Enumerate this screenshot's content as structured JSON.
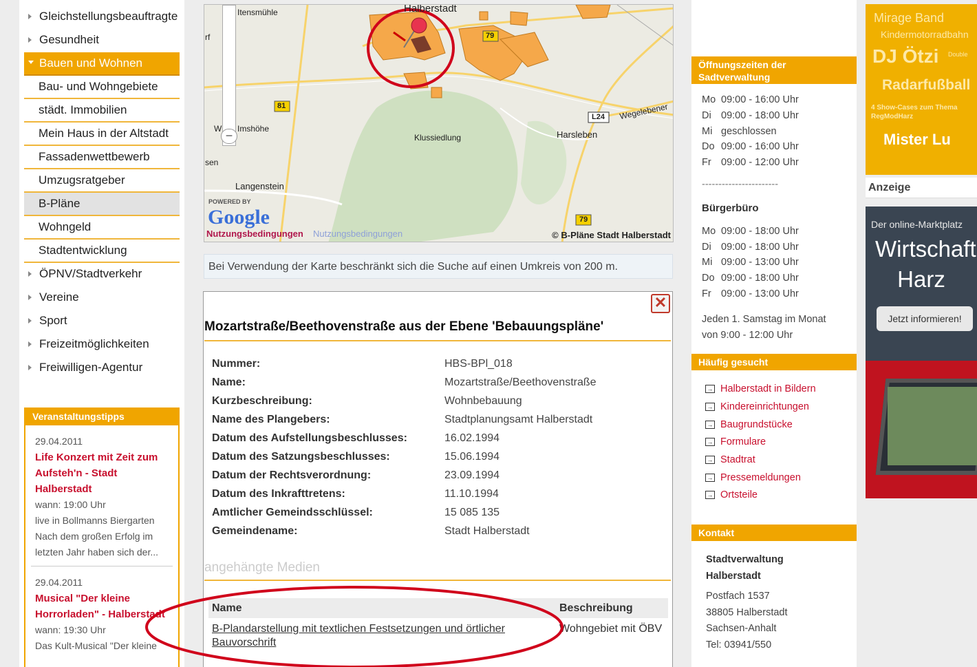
{
  "nav": {
    "items": [
      {
        "label": "Gleichstellungsbeauftragte",
        "type": "top"
      },
      {
        "label": "Gesundheit",
        "type": "top"
      },
      {
        "label": "Bauen und Wohnen",
        "type": "active"
      },
      {
        "label": "Bau- und Wohngebiete",
        "type": "sub"
      },
      {
        "label": "städt. Immobilien",
        "type": "sub"
      },
      {
        "label": "Mein Haus in der Altstadt",
        "type": "sub"
      },
      {
        "label": "Fassadenwettbewerb",
        "type": "sub"
      },
      {
        "label": "Umzugsratgeber",
        "type": "sub"
      },
      {
        "label": "B-Pläne",
        "type": "current"
      },
      {
        "label": "Wohngeld",
        "type": "sub"
      },
      {
        "label": "Stadtentwicklung",
        "type": "sub"
      },
      {
        "label": "ÖPNV/Stadtverkehr",
        "type": "top"
      },
      {
        "label": "Vereine",
        "type": "top"
      },
      {
        "label": "Sport",
        "type": "top"
      },
      {
        "label": "Freizeitmöglichkeiten",
        "type": "top"
      },
      {
        "label": "Freiwilligen-Agentur",
        "type": "top"
      }
    ]
  },
  "events": {
    "heading": "Veranstaltungstipps",
    "items": [
      {
        "date": "29.04.2011",
        "title": "Life Konzert mit Zeit zum Aufsteh'n - Stadt Halberstadt",
        "when": "wann: 19:00   Uhr",
        "desc": "live in Bollmanns Biergarten Nach dem großen Erfolg im letzten Jahr haben sich der..."
      },
      {
        "date": "29.04.2011",
        "title": "Musical \"Der kleine Horrorladen\" - Halberstadt",
        "when": "wann: 19:30   Uhr",
        "desc": "Das Kult-Musical \"Der kleine"
      }
    ]
  },
  "map": {
    "labels": {
      "halberstadt": "Halberstadt",
      "spiegelsberge": "Itensmühle",
      "imshoehe": "Imshöhe",
      "klussiedlung": "Klussiedlung",
      "harsleben": "Harsleben",
      "langenstein": "Langenstein",
      "wegeleben": "Wegelebener",
      "road81": "81",
      "road79a": "79",
      "road79b": "79",
      "l24": "L24",
      "rf": "rf",
      "sen": "sen",
      "w": "W"
    },
    "powered": "POWERED BY",
    "google": "Google",
    "terms": "Nutzungsbedingungen",
    "terms_ghost": "Nutzungsbedingungen",
    "copyright": "© B-Pläne Stadt Halberstadt",
    "zoom_minus": "−"
  },
  "hint": "Bei Verwendung der Karte beschränkt sich die Suche auf einen Umkreis von 200 m.",
  "popup": {
    "close": "✕",
    "title": "Mozartstraße/Beethovenstraße aus der Ebene 'Bebauungspläne'",
    "details": [
      {
        "k": "Nummer:",
        "v": "HBS-BPl_018"
      },
      {
        "k": "Name:",
        "v": "Mozartstraße/Beethovenstraße"
      },
      {
        "k": "Kurzbeschreibung:",
        "v": "Wohnbebauung"
      },
      {
        "k": "Name des Plangebers:",
        "v": "Stadtplanungsamt Halberstadt"
      },
      {
        "k": "Datum des Aufstellungsbeschlusses:",
        "v": "16.02.1994"
      },
      {
        "k": "Datum des Satzungsbeschlusses:",
        "v": "15.06.1994"
      },
      {
        "k": "Datum der Rechtsverordnung:",
        "v": "23.09.1994"
      },
      {
        "k": "Datum des Inkrafttretens:",
        "v": "11.10.1994"
      },
      {
        "k": "Amtlicher Gemeindsschlüssel:",
        "v": "15 085 135"
      },
      {
        "k": "Gemeindename:",
        "v": "Stadt Halberstadt"
      }
    ],
    "media_heading": "angehängte Medien",
    "media_cols": {
      "name": "Name",
      "desc": "Beschreibung"
    },
    "media_row": {
      "name": "B-Plandarstellung mit textlichen Festsetzungen und örtlicher Bauvorschrift",
      "desc": "Wohngebiet mit ÖBV"
    }
  },
  "right": {
    "hours_heading": "Öffnungszeiten der Sadtverwaltung",
    "hours": [
      {
        "d": "Mo",
        "t": "09:00 - 16:00 Uhr"
      },
      {
        "d": "Di",
        "t": "09:00 - 18:00 Uhr"
      },
      {
        "d": "Mi",
        "t": "geschlossen"
      },
      {
        "d": "Do",
        "t": "09:00 - 16:00 Uhr"
      },
      {
        "d": "Fr",
        "t": "09:00 - 12:00 Uhr"
      }
    ],
    "sep": "-----------------------",
    "buero_heading": "Bürgerbüro",
    "buero_hours": [
      {
        "d": "Mo",
        "t": "09:00 - 18:00 Uhr"
      },
      {
        "d": "Di",
        "t": "09:00 - 18:00 Uhr"
      },
      {
        "d": "Mi",
        "t": "09:00 - 13:00 Uhr"
      },
      {
        "d": "Do",
        "t": "09:00 - 18:00 Uhr"
      },
      {
        "d": "Fr",
        "t": "09:00 - 13:00 Uhr"
      }
    ],
    "saturday": "Jeden 1. Samstag im Monat von 9:00 - 12:00 Uhr",
    "frequent_heading": "Häufig gesucht",
    "links": [
      "Halberstadt in Bildern",
      "Kindereinrichtungen",
      "Baugrundstücke",
      "Formulare",
      "Stadtrat",
      "Pressemeldungen",
      "Ortsteile"
    ],
    "contact_heading": "Kontakt",
    "contact_name": "Stadtverwaltung Halberstadt",
    "contact_lines": [
      "Postfach 1537",
      "38805 Halberstadt",
      "Sachsen-Anhalt",
      "Tel: 03941/550"
    ]
  },
  "ads": {
    "top": {
      "l1": "Mirage Band",
      "l2": "Kindermotorradbahn",
      "l3": "DJ Ötzi",
      "l3s": "Double",
      "l4": "Radarfußball",
      "l5": "4 Show-Cases zum Thema RegModHarz",
      "l6": "Mister Lu"
    },
    "label": "Anzeige",
    "bottom": {
      "b1": "Der online-Marktplatz",
      "b2": "Wirtschaft Harz",
      "b3": "Jetzt informieren!"
    }
  },
  "colors": {
    "accent": "#f0a500",
    "link": "#c8102e",
    "annotation": "#d0021b"
  }
}
